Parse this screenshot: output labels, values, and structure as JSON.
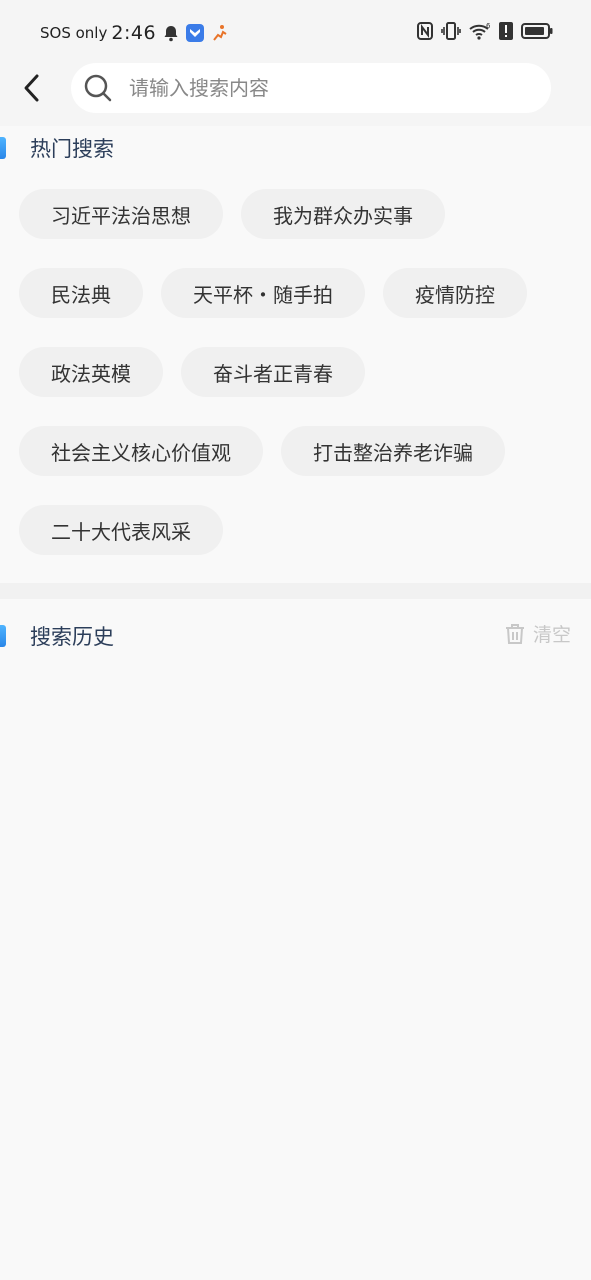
{
  "status_bar": {
    "carrier": "SOS only",
    "time": "2:46"
  },
  "search": {
    "placeholder": "请输入搜索内容"
  },
  "hot": {
    "title": "热门搜索",
    "rows": [
      [
        "习近平法治思想",
        "我为群众办实事"
      ],
      [
        "民法典",
        "天平杯・随手拍",
        "疫情防控"
      ],
      [
        "政法英模",
        "奋斗者正青春"
      ],
      [
        "社会主义核心价值观",
        "打击整治养老诈骗"
      ],
      [
        "二十大代表风采"
      ]
    ]
  },
  "history": {
    "title": "搜索历史",
    "clear_label": "清空"
  },
  "colors": {
    "accent": "#2a86e8",
    "background": "#f9f9f9",
    "tag_bg": "#f0f0f0",
    "section_title": "#2c3e5a"
  }
}
